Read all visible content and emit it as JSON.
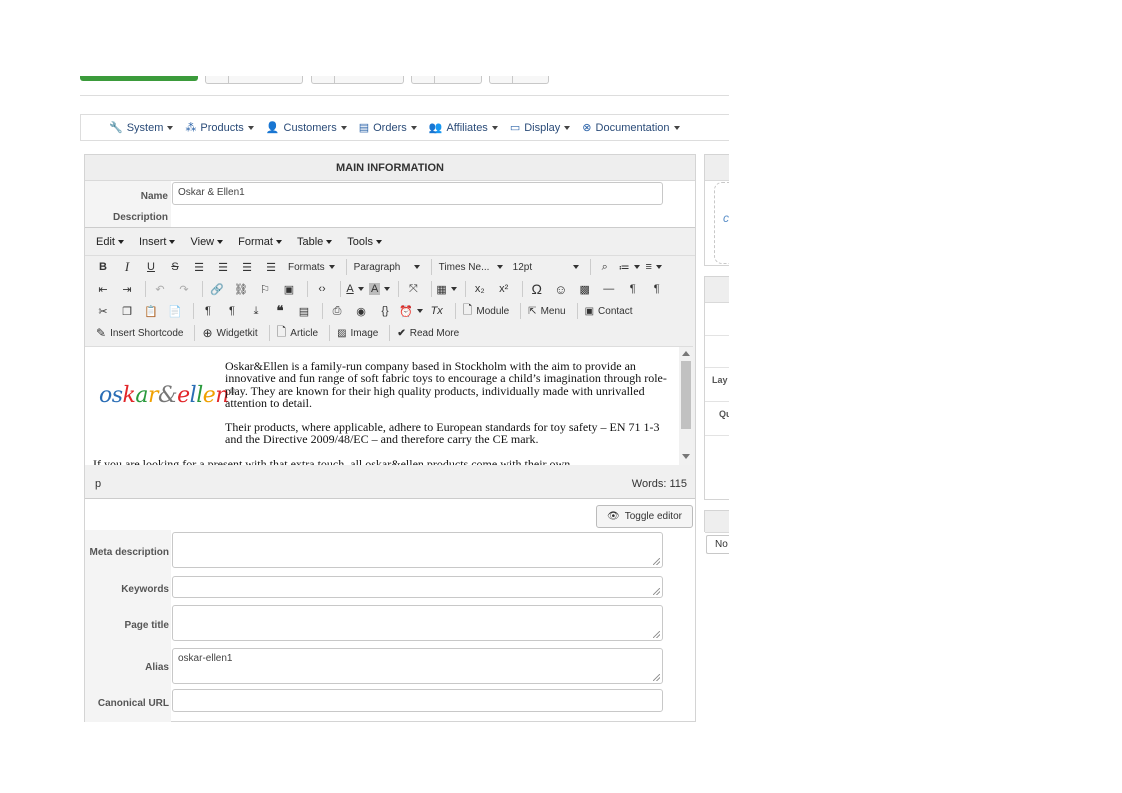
{
  "menubar": {
    "items": [
      {
        "label": "System",
        "icon": "wrench-icon"
      },
      {
        "label": "Products",
        "icon": "cubes-icon"
      },
      {
        "label": "Customers",
        "icon": "user-icon"
      },
      {
        "label": "Orders",
        "icon": "orders-icon"
      },
      {
        "label": "Affiliates",
        "icon": "users-icon"
      },
      {
        "label": "Display",
        "icon": "monitor-icon"
      },
      {
        "label": "Documentation",
        "icon": "lifebuoy-icon"
      }
    ]
  },
  "main": {
    "title": "MAIN INFORMATION",
    "name_label": "Name",
    "name_value": "Oskar & Ellen1",
    "description_label": "Description",
    "meta_description_label": "Meta description",
    "keywords_label": "Keywords",
    "page_title_label": "Page title",
    "alias_label": "Alias",
    "alias_value": "oskar-ellen1",
    "canonical_label": "Canonical URL",
    "toggle_editor": "Toggle editor"
  },
  "editor": {
    "menus": [
      "Edit",
      "Insert",
      "View",
      "Format",
      "Table",
      "Tools"
    ],
    "formats": "Formats",
    "block": "Paragraph",
    "font": "Times Ne...",
    "size": "12pt",
    "module": "Module",
    "menu": "Menu",
    "contact": "Contact",
    "insert_shortcode": "Insert Shortcode",
    "widgetkit": "Widgetkit",
    "article": "Article",
    "image": "Image",
    "read_more": "Read More",
    "logo_text": "oskar&ellen",
    "para1": "Oskar&Ellen is a family-run company based in Stockholm with the aim to provide an innovative and fun range of soft fabric toys to encourage a child’s imagination through role-play. They are known for their high quality products, individually made with unrivalled attention to detail.",
    "para2": "Their products, where applicable, adhere to European standards for toy safety – EN 71 1-3 and the Directive 2009/48/EC – and therefore carry the CE mark.",
    "para3": "If you are looking for a present with that extra touch, all oskar&ellen products come with their own",
    "path": "p",
    "words": "Words: 115"
  },
  "right": {
    "lay": "Lay",
    "qu": "Qu",
    "no": "No"
  }
}
